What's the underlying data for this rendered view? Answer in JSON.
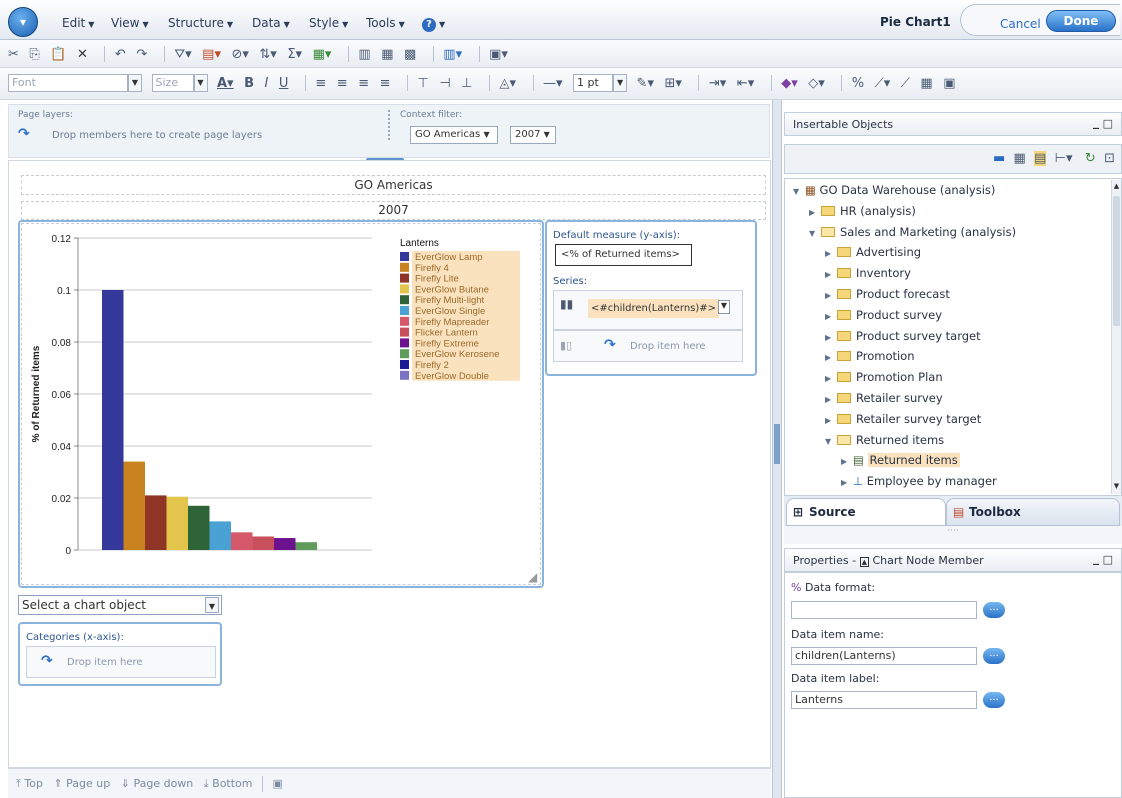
{
  "menu": {
    "items": [
      "Edit",
      "View",
      "Structure",
      "Data",
      "Style",
      "Tools"
    ],
    "report_title": "Pie Chart1",
    "cancel": "Cancel",
    "done": "Done"
  },
  "format_toolbar": {
    "font_placeholder": "Font",
    "size_placeholder": "Size",
    "line_weight": "1 pt"
  },
  "page_layers": {
    "label": "Page layers:",
    "hint": "Drop members here to create page layers"
  },
  "context_filter": {
    "label": "Context filter:",
    "region": "GO Americas",
    "year": "2007"
  },
  "report": {
    "header_region": "GO Americas",
    "header_year": "2007"
  },
  "chart_data": {
    "type": "bar",
    "ylabel": "% of Returned items",
    "ylim": [
      0,
      0.12
    ],
    "yticks": [
      "0",
      "0.02",
      "0.04",
      "0.06",
      "0.08",
      "0.1",
      "0.12"
    ],
    "legend_title": "Lanterns",
    "legend_position": "right",
    "grid": true,
    "categories": [
      "EverGlow Lamp",
      "Firefly 4",
      "Firefly Lite",
      "EverGlow Butane",
      "Firefly Multi-light",
      "EverGlow Single",
      "Firefly Mapreader",
      "Flicker Lantern",
      "Firefly Extreme",
      "EverGlow Kerosene",
      "Firefly 2",
      "EverGlow Double"
    ],
    "values": [
      0.1,
      0.034,
      0.021,
      0.0205,
      0.017,
      0.011,
      0.0068,
      0.0052,
      0.0046,
      0.003,
      0,
      0
    ],
    "colors": [
      "#34389b",
      "#c8821f",
      "#8e3525",
      "#e2c54a",
      "#2e6437",
      "#4aa2d4",
      "#d6596b",
      "#c8505c",
      "#6d128f",
      "#5f9c5c",
      "#1b1b98",
      "#7a73c4"
    ]
  },
  "measure_panel": {
    "title": "Default measure (y-axis):",
    "measure": "<% of Returned items>",
    "series_label": "Series:",
    "series_item": "<#children(Lanterns)#>",
    "drop_hint": "Drop item here"
  },
  "chart_object_select": "Select a chart object",
  "categories_panel": {
    "title": "Categories (x-axis):",
    "drop_hint": "Drop item here"
  },
  "status_bar": {
    "top": "Top",
    "page_up": "Page up",
    "page_down": "Page down",
    "bottom": "Bottom"
  },
  "insertable_objects": {
    "title": "Insertable Objects",
    "tree": [
      {
        "label": "GO Data Warehouse (analysis)",
        "level": 0,
        "expanded": true,
        "kind": "package"
      },
      {
        "label": "HR (analysis)",
        "level": 1,
        "expanded": false,
        "kind": "folder"
      },
      {
        "label": "Sales and Marketing (analysis)",
        "level": 1,
        "expanded": true,
        "kind": "folder"
      },
      {
        "label": "Advertising",
        "level": 2,
        "expanded": false,
        "kind": "folder"
      },
      {
        "label": "Inventory",
        "level": 2,
        "expanded": false,
        "kind": "folder"
      },
      {
        "label": "Product forecast",
        "level": 2,
        "expanded": false,
        "kind": "folder"
      },
      {
        "label": "Product survey",
        "level": 2,
        "expanded": false,
        "kind": "folder"
      },
      {
        "label": "Product survey target",
        "level": 2,
        "expanded": false,
        "kind": "folder"
      },
      {
        "label": "Promotion",
        "level": 2,
        "expanded": false,
        "kind": "folder"
      },
      {
        "label": "Promotion Plan",
        "level": 2,
        "expanded": false,
        "kind": "folder"
      },
      {
        "label": "Retailer survey",
        "level": 2,
        "expanded": false,
        "kind": "folder"
      },
      {
        "label": "Retailer survey target",
        "level": 2,
        "expanded": false,
        "kind": "folder"
      },
      {
        "label": "Returned items",
        "level": 2,
        "expanded": true,
        "kind": "folder"
      },
      {
        "label": "Returned items",
        "level": 3,
        "expanded": false,
        "kind": "measure",
        "selected": true
      },
      {
        "label": "Employee by manager",
        "level": 3,
        "expanded": false,
        "kind": "hierarchy"
      }
    ]
  },
  "source_tabs": {
    "source": "Source",
    "toolbox": "Toolbox"
  },
  "properties": {
    "title": "Properties -",
    "object": "Chart Node Member",
    "data_format_label": "Data format:",
    "data_format_value": "",
    "data_item_name_label": "Data item name:",
    "data_item_name_value": "children(Lanterns)",
    "data_item_label_label": "Data item label:",
    "data_item_label_value": "Lanterns",
    "button": "..."
  }
}
